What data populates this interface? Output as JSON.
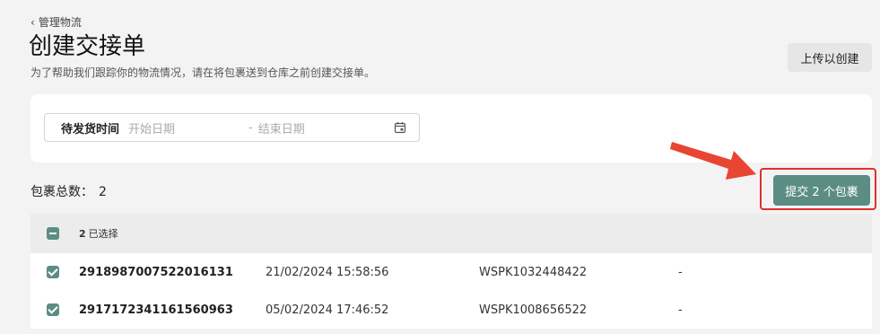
{
  "header": {
    "back_label": "管理物流",
    "title": "创建交接单",
    "subtitle": "为了帮助我们跟踪你的物流情况，请在将包裹送到仓库之前创建交接单。",
    "upload_button": "上传以创建"
  },
  "filter": {
    "label": "待发货时间",
    "start_placeholder": "开始日期",
    "separator": "-",
    "end_placeholder": "结束日期"
  },
  "package_count_label": "包裹总数：",
  "package_count": "2",
  "submit_button": "提交 2 个包裹",
  "table": {
    "selected_count": "2",
    "selected_label": "已选择",
    "rows": [
      {
        "id": "2918987007522016131",
        "time": "21/02/2024 15:58:56",
        "ref": "WSPK1032448422",
        "extra": "-"
      },
      {
        "id": "2917172341161560963",
        "time": "05/02/2024 17:46:52",
        "ref": "WSPK1008656522",
        "extra": "-"
      }
    ]
  },
  "colors": {
    "accent": "#5c8d84",
    "highlight": "#e0302a"
  },
  "icons": [
    "chevron-left-icon",
    "calendar-icon",
    "arrow-annotation"
  ]
}
